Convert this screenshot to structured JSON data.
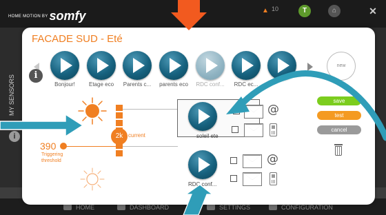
{
  "app": {
    "brand_small": "HOME MOTION BY",
    "brand": "somfy",
    "side_label": "MY SENSORS",
    "notif_count": "10"
  },
  "bottom_nav": [
    {
      "label": "HOME"
    },
    {
      "label": "DASHBOARD"
    },
    {
      "label": "SETTINGS"
    },
    {
      "label": "CONFIGURATION"
    }
  ],
  "dialog": {
    "title": "FACADE SUD - Eté",
    "scenarios": [
      {
        "label": "Bonjour!",
        "dim": false
      },
      {
        "label": "Etage eco",
        "dim": false
      },
      {
        "label": "Parents c...",
        "dim": false
      },
      {
        "label": "parents eco",
        "dim": false
      },
      {
        "label": "RDC conf...",
        "dim": true
      },
      {
        "label": "RDC ec...",
        "dim": false
      },
      {
        "label": "",
        "dim": false
      }
    ],
    "new_label": "new",
    "current": {
      "value": "2k",
      "label": "current"
    },
    "threshold": {
      "value": "390",
      "label_line1": "Triggering",
      "label_line2": "threshold"
    },
    "assigned": [
      {
        "label": "soleil ete"
      },
      {
        "label": "RDC conf..."
      }
    ],
    "actions": {
      "save": "save",
      "test": "test",
      "cancel": "cancel"
    },
    "colors": {
      "accent": "#f07f22",
      "save": "#7ccd1e",
      "test": "#f49a22",
      "cancel": "#9a9a9a",
      "play": "#17627f",
      "annotation": "#2f9db8"
    }
  }
}
